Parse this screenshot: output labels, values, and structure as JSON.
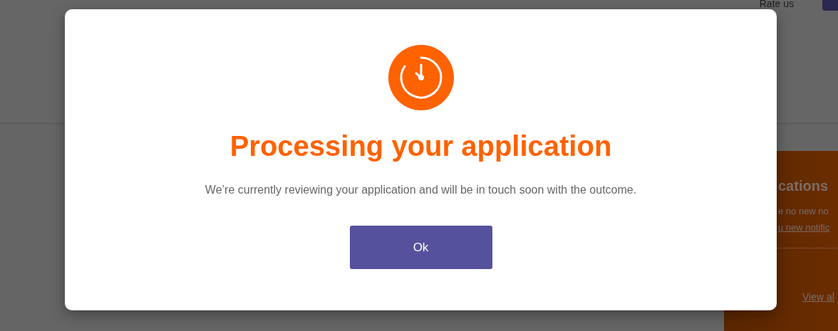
{
  "header": {
    "rate_link": "Rate us"
  },
  "notifications_panel": {
    "title": "cations",
    "message": "e no new no",
    "link": "u new notific",
    "footer_link": "View al"
  },
  "dialog": {
    "title": "Processing your application",
    "message": "We’re currently reviewing your application and will be in touch soon with the outcome.",
    "button": "Ok"
  }
}
